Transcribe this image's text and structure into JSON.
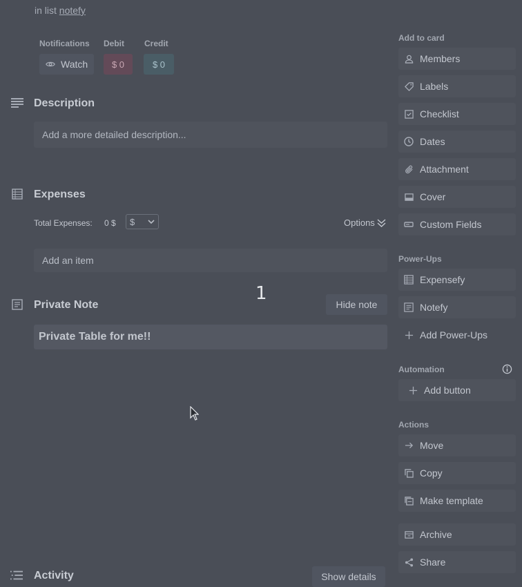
{
  "header": {
    "in_list_prefix": "in list",
    "list_name": "notefy"
  },
  "meta": {
    "notifications_label": "Notifications",
    "watch_label": "Watch",
    "debit_label": "Debit",
    "debit_value": "$ 0",
    "credit_label": "Credit",
    "credit_value": "$ 0"
  },
  "description": {
    "title": "Description",
    "placeholder": "Add a more detailed description..."
  },
  "expenses": {
    "title": "Expenses",
    "total_label": "Total Expenses:",
    "total_value": "0 $",
    "currency": "$",
    "options_label": "Options",
    "add_item": "Add an item"
  },
  "private_note": {
    "title": "Private Note",
    "hide_label": "Hide note",
    "content": "Private Table for me!!",
    "counter": "1"
  },
  "activity": {
    "title": "Activity",
    "show_details": "Show details"
  },
  "sidebar": {
    "add_to_card": {
      "heading": "Add to card",
      "items": [
        {
          "label": "Members",
          "icon": "person-icon"
        },
        {
          "label": "Labels",
          "icon": "tag-icon"
        },
        {
          "label": "Checklist",
          "icon": "checkbox-icon"
        },
        {
          "label": "Dates",
          "icon": "clock-icon"
        },
        {
          "label": "Attachment",
          "icon": "paperclip-icon"
        },
        {
          "label": "Cover",
          "icon": "cover-icon"
        },
        {
          "label": "Custom Fields",
          "icon": "custom-fields-icon"
        }
      ]
    },
    "power_ups": {
      "heading": "Power-Ups",
      "items": [
        {
          "label": "Expensefy",
          "icon": "expensefy-icon"
        },
        {
          "label": "Notefy",
          "icon": "notefy-icon"
        },
        {
          "label": "Add Power-Ups",
          "icon": "plus-icon"
        }
      ]
    },
    "automation": {
      "heading": "Automation",
      "add_button": "Add button"
    },
    "actions": {
      "heading": "Actions",
      "items": [
        {
          "label": "Move",
          "icon": "arrow-right-icon"
        },
        {
          "label": "Copy",
          "icon": "copy-icon"
        },
        {
          "label": "Make template",
          "icon": "template-icon"
        },
        {
          "label": "Archive",
          "icon": "archive-icon"
        },
        {
          "label": "Share",
          "icon": "share-icon"
        }
      ]
    }
  }
}
